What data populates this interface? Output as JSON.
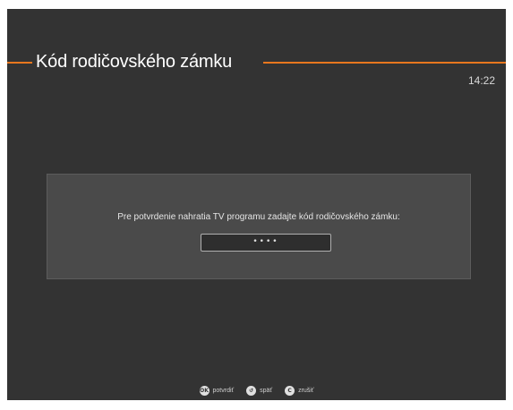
{
  "header": {
    "title": "Kód rodičovského zámku",
    "clock": "14:22",
    "accent_color": "#e8771e"
  },
  "dialog": {
    "message": "Pre potvrdenie nahratia TV programu zadajte kód rodičovského zámku:",
    "pin_value": "••••"
  },
  "footer": {
    "hints": [
      {
        "icon": "ok-button-icon",
        "glyph": "OK",
        "label": "potvrdiť"
      },
      {
        "icon": "back-button-icon",
        "glyph": "↺",
        "label": "späť"
      },
      {
        "icon": "cancel-button-icon",
        "glyph": "C",
        "label": "zrušiť"
      }
    ]
  }
}
